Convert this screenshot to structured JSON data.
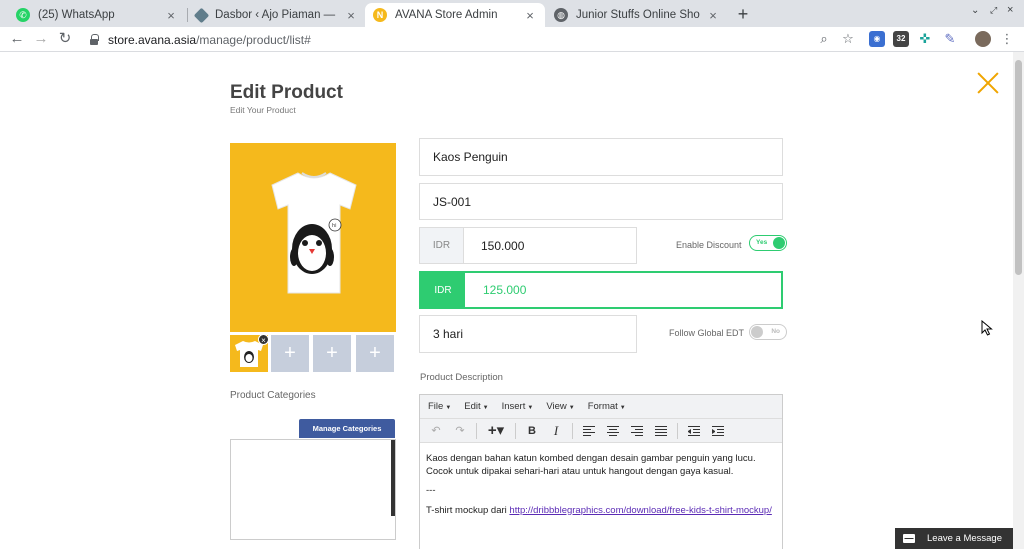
{
  "browser": {
    "tabs": [
      {
        "title": "(25) WhatsApp",
        "active": false
      },
      {
        "title": "Dasbor ‹ Ajo Piaman — Word",
        "active": false
      },
      {
        "title": "AVANA Store Admin",
        "active": true
      },
      {
        "title": "Junior Stuffs Online Shopping",
        "active": false
      }
    ],
    "url_host": "store.avana.asia",
    "url_path": "/manage/product/list#",
    "extension_badge": "32"
  },
  "header": {
    "title": "Edit Product",
    "subtitle": "Edit Your Product"
  },
  "product": {
    "name": "Kaos Penguin",
    "sku": "JS-001",
    "currency": "IDR",
    "price": "150.000",
    "discount_price": "125.000",
    "edt": "3 hari",
    "enable_discount_label": "Enable Discount",
    "enable_discount_state": "Yes",
    "follow_edt_label": "Follow Global EDT",
    "follow_edt_state": "No"
  },
  "categories": {
    "label": "Product Categories",
    "manage_button": "Manage Categories"
  },
  "thumbs": {
    "add_symbol": "+",
    "remove_symbol": "×"
  },
  "description": {
    "label": "Product Description",
    "menus": [
      "File",
      "Edit",
      "Insert",
      "View",
      "Format"
    ],
    "paragraph1": "Kaos dengan bahan katun kombed dengan desain gambar penguin yang lucu. Cocok untuk dipakai sehari-hari atau untuk hangout dengan gaya kasual.",
    "separator": "---",
    "credit_prefix": "T-shirt mockup dari ",
    "credit_link": "http://dribbblegraphics.com/download/free-kids-t-shirt-mockup/"
  },
  "chat": {
    "label": "Leave a Message"
  },
  "colors": {
    "accent_orange": "#f0a500",
    "product_bg": "#f5b91c",
    "discount_green": "#2ecc71",
    "button_blue": "#3f5b9f"
  }
}
